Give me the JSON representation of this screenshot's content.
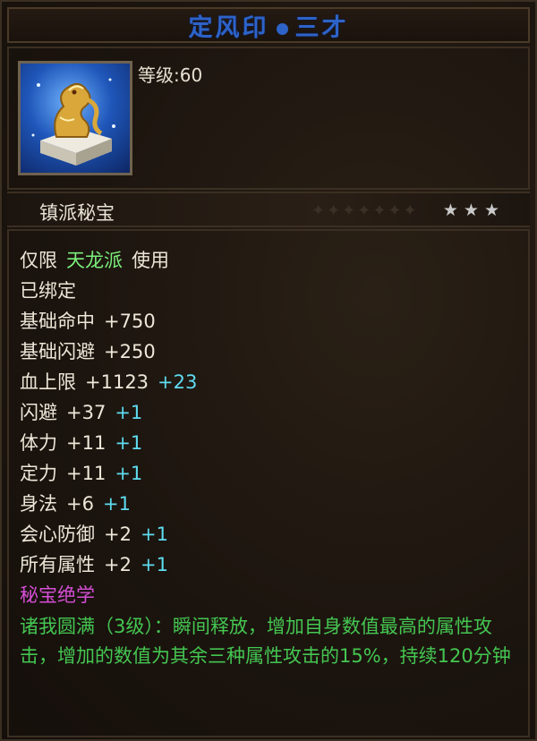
{
  "title": {
    "name": "定风印",
    "suffix": "三才"
  },
  "level": "等级:60",
  "item_type": "镇派秘宝",
  "stars": [
    "★",
    "★",
    "★"
  ],
  "restriction": {
    "prefix": "仅限",
    "sect": "天龙派",
    "suffix": "使用"
  },
  "bound": "已绑定",
  "stats": [
    {
      "label": "基础命中",
      "value": "+750",
      "bonus": ""
    },
    {
      "label": "基础闪避",
      "value": "+250",
      "bonus": ""
    },
    {
      "label": "血上限",
      "value": "+1123",
      "bonus": "+23"
    },
    {
      "label": "闪避",
      "value": "+37",
      "bonus": "+1"
    },
    {
      "label": "体力",
      "value": "+11",
      "bonus": "+1"
    },
    {
      "label": "定力",
      "value": "+11",
      "bonus": "+1"
    },
    {
      "label": "身法",
      "value": "+6",
      "bonus": "+1"
    },
    {
      "label": "会心防御",
      "value": "+2",
      "bonus": "+1"
    },
    {
      "label": "所有属性",
      "value": "+2",
      "bonus": "+1"
    }
  ],
  "skill_header": "秘宝绝学",
  "skill_desc": "诸我圆满（3级）：瞬间释放，增加自身数值最高的属性攻击，增加的数值为其余三种属性攻击的15%，持续120分钟",
  "colors": {
    "title": "#2d63c9",
    "sect": "#7cf07c",
    "bonus": "#5fdcf0",
    "skill_header": "#d44fd4",
    "skill_desc": "#44c651"
  }
}
